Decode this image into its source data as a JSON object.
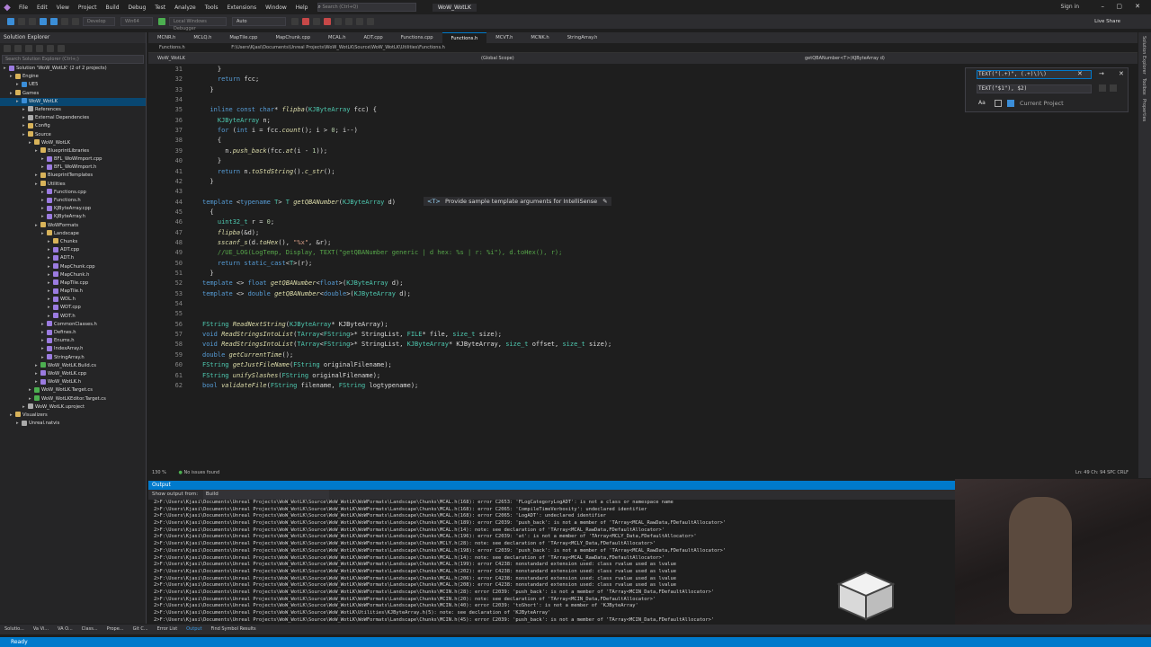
{
  "titlebar": {
    "menus": [
      "File",
      "Edit",
      "View",
      "Project",
      "Build",
      "Debug",
      "Test",
      "Analyze",
      "Tools",
      "Extensions",
      "Window",
      "Help"
    ],
    "search_placeholder": "Search (Ctrl+Q)",
    "solution_name": "WoW_WotLK",
    "signin": "Sign in",
    "liveshare": "Live Share"
  },
  "toolbar": {
    "config": "Develop",
    "platform": "Win64",
    "debugger": "Local Windows Debugger",
    "auto": "Auto"
  },
  "solution_explorer": {
    "title": "Solution Explorer",
    "search_placeholder": "Search Solution Explorer (Ctrl+;)",
    "items": [
      {
        "label": "Solution 'WoW_WotLK' (2 of 2 projects)",
        "indent": 0,
        "color": "#9b7be0"
      },
      {
        "label": "Engine",
        "indent": 1,
        "color": "#d8b35a"
      },
      {
        "label": "UE5",
        "indent": 2,
        "color": "#3b8ed8"
      },
      {
        "label": "Games",
        "indent": 1,
        "color": "#d8b35a"
      },
      {
        "label": "WoW_WotLK",
        "indent": 2,
        "color": "#3b8ed8",
        "selected": true
      },
      {
        "label": "References",
        "indent": 3,
        "color": "#aaaaaa"
      },
      {
        "label": "External Dependencies",
        "indent": 3,
        "color": "#aaaaaa"
      },
      {
        "label": "Config",
        "indent": 3,
        "color": "#d8b35a"
      },
      {
        "label": "Source",
        "indent": 3,
        "color": "#d8b35a"
      },
      {
        "label": "WoW_WotLK",
        "indent": 4,
        "color": "#d8b35a"
      },
      {
        "label": "BlueprintLibraries",
        "indent": 5,
        "color": "#d8b35a"
      },
      {
        "label": "BFL_WoWImport.cpp",
        "indent": 6,
        "color": "#9b7be0"
      },
      {
        "label": "BFL_WoWImport.h",
        "indent": 6,
        "color": "#9b7be0"
      },
      {
        "label": "BlueprintTemplates",
        "indent": 5,
        "color": "#d8b35a"
      },
      {
        "label": "Utilities",
        "indent": 5,
        "color": "#d8b35a"
      },
      {
        "label": "Functions.cpp",
        "indent": 6,
        "color": "#9b7be0"
      },
      {
        "label": "Functions.h",
        "indent": 6,
        "color": "#9b7be0"
      },
      {
        "label": "KJByteArray.cpp",
        "indent": 6,
        "color": "#9b7be0"
      },
      {
        "label": "KJByteArray.h",
        "indent": 6,
        "color": "#9b7be0"
      },
      {
        "label": "WoWFormats",
        "indent": 5,
        "color": "#d8b35a"
      },
      {
        "label": "Landscape",
        "indent": 6,
        "color": "#d8b35a"
      },
      {
        "label": "Chunks",
        "indent": 7,
        "color": "#d8b35a"
      },
      {
        "label": "ADT.cpp",
        "indent": 7,
        "color": "#9b7be0"
      },
      {
        "label": "ADT.h",
        "indent": 7,
        "color": "#9b7be0"
      },
      {
        "label": "MapChunk.cpp",
        "indent": 7,
        "color": "#9b7be0"
      },
      {
        "label": "MapChunk.h",
        "indent": 7,
        "color": "#9b7be0"
      },
      {
        "label": "MapTile.cpp",
        "indent": 7,
        "color": "#9b7be0"
      },
      {
        "label": "MapTile.h",
        "indent": 7,
        "color": "#9b7be0"
      },
      {
        "label": "WDL.h",
        "indent": 7,
        "color": "#9b7be0"
      },
      {
        "label": "WDT.cpp",
        "indent": 7,
        "color": "#9b7be0"
      },
      {
        "label": "WDT.h",
        "indent": 7,
        "color": "#9b7be0"
      },
      {
        "label": "CommonClasses.h",
        "indent": 6,
        "color": "#9b7be0"
      },
      {
        "label": "Defines.h",
        "indent": 6,
        "color": "#9b7be0"
      },
      {
        "label": "Enums.h",
        "indent": 6,
        "color": "#9b7be0"
      },
      {
        "label": "IndexArray.h",
        "indent": 6,
        "color": "#9b7be0"
      },
      {
        "label": "StringArray.h",
        "indent": 6,
        "color": "#9b7be0"
      },
      {
        "label": "WoW_WotLK.Build.cs",
        "indent": 5,
        "color": "#4caf50"
      },
      {
        "label": "WoW_WotLK.cpp",
        "indent": 5,
        "color": "#9b7be0"
      },
      {
        "label": "WoW_WotLK.h",
        "indent": 5,
        "color": "#9b7be0"
      },
      {
        "label": "WoW_WotLK.Target.cs",
        "indent": 4,
        "color": "#4caf50"
      },
      {
        "label": "WoW_WotLKEditor.Target.cs",
        "indent": 4,
        "color": "#4caf50"
      },
      {
        "label": "WoW_WotLK.uproject",
        "indent": 3,
        "color": "#aaaaaa"
      },
      {
        "label": "Visualizers",
        "indent": 1,
        "color": "#d8b35a"
      },
      {
        "label": "Unreal.natvis",
        "indent": 2,
        "color": "#aaaaaa"
      }
    ]
  },
  "tabs": [
    {
      "label": "MCNR.h"
    },
    {
      "label": "MCLQ.h"
    },
    {
      "label": "MapTile.cpp"
    },
    {
      "label": "MapChunk.cpp"
    },
    {
      "label": "MCAL.h"
    },
    {
      "label": "ADT.cpp"
    },
    {
      "label": "Functions.cpp"
    },
    {
      "label": "Functions.h",
      "active": true
    },
    {
      "label": "MCVT.h"
    },
    {
      "label": "MCNK.h"
    },
    {
      "label": "StringArray.h"
    }
  ],
  "pathbar": {
    "file": "Functions.h",
    "path": "F:\\Users\\Kjasi\\Documents\\Unreal Projects\\WoW_WotLK\\Source\\WoW_WotLK\\Utilities\\Functions.h"
  },
  "navbar": {
    "project": "WoW_WotLK",
    "scope": "(Global Scope)",
    "member": "getQBANumber<T>(KJByteArray d)"
  },
  "editor": {
    "lines": [
      {
        "n": "31",
        "html": "    }"
      },
      {
        "n": "32",
        "html": "    <span class=\"kw\">return</span> fcc;"
      },
      {
        "n": "33",
        "html": "  }"
      },
      {
        "n": "34",
        "html": ""
      },
      {
        "n": "35",
        "html": "  <span class=\"kw\">inline const char</span>* <span class=\"fn\">flipba</span>(<span class=\"ty\">KJByteArray</span> fcc) {"
      },
      {
        "n": "36",
        "html": "    <span class=\"ty\">KJByteArray</span> n;"
      },
      {
        "n": "37",
        "html": "    <span class=\"kw\">for</span> (<span class=\"kw\">int</span> i = fcc.<span class=\"fn\">count</span>(); i &gt; <span class=\"num\">0</span>; i--)"
      },
      {
        "n": "38",
        "html": "    {"
      },
      {
        "n": "39",
        "html": "      n.<span class=\"fn\">push_back</span>(fcc.<span class=\"fn\">at</span>(i - <span class=\"num\">1</span>));"
      },
      {
        "n": "40",
        "html": "    }"
      },
      {
        "n": "41",
        "html": "    <span class=\"kw\">return</span> n.<span class=\"fn\">toStdString</span>().<span class=\"fn\">c_str</span>();"
      },
      {
        "n": "42",
        "html": "  }"
      },
      {
        "n": "43",
        "html": ""
      },
      {
        "n": "44",
        "html": "<span class=\"kw\">template</span> &lt;<span class=\"kw\">typename</span> <span class=\"ty\">T</span>&gt; <span class=\"ty\">T</span> <span class=\"fn\">getQBANumber</span>(<span class=\"ty\">KJByteArray</span> d)"
      },
      {
        "n": "45",
        "html": "  {"
      },
      {
        "n": "46",
        "html": "    <span class=\"ty\">uint32_t</span> r = <span class=\"num\">0</span>;"
      },
      {
        "n": "47",
        "html": "    <span class=\"fn\">flipba</span>(&amp;d);"
      },
      {
        "n": "48",
        "html": "    <span class=\"fn\">sscanf_s</span>(d.<span class=\"fn\">toHex</span>(), <span class=\"str\">\"%x\"</span>, &amp;r);"
      },
      {
        "n": "49",
        "html": "    <span class=\"cm\">//UE_LOG(LogTemp, Display, TEXT(\"getQBANumber generic | d hex: %s | r: %i\"), d.toHex(), r);</span>"
      },
      {
        "n": "50",
        "html": "    <span class=\"kw\">return</span> <span class=\"kw\">static_cast</span>&lt;<span class=\"ty\">T</span>&gt;(r);"
      },
      {
        "n": "51",
        "html": "  }"
      },
      {
        "n": "52",
        "html": "<span class=\"kw\">template</span> &lt;&gt; <span class=\"kw\">float</span> <span class=\"fn\">getQBANumber</span>&lt;<span class=\"kw\">float</span>&gt;(<span class=\"ty\">KJByteArray</span> d);"
      },
      {
        "n": "53",
        "html": "<span class=\"kw\">template</span> &lt;&gt; <span class=\"kw\">double</span> <span class=\"fn\">getQBANumber</span>&lt;<span class=\"kw\">double</span>&gt;(<span class=\"ty\">KJByteArray</span> d);"
      },
      {
        "n": "54",
        "html": ""
      },
      {
        "n": "55",
        "html": ""
      },
      {
        "n": "56",
        "html": "<span class=\"ty\">FString</span> <span class=\"fn\">ReadNextString</span>(<span class=\"ty\">KJByteArray</span>* KJByteArray);"
      },
      {
        "n": "57",
        "html": "<span class=\"kw\">void</span> <span class=\"fn\">ReadStringsIntoList</span>(<span class=\"ty\">TArray</span>&lt;<span class=\"ty\">FString</span>&gt;* StringList, <span class=\"ty\">FILE</span>* file, <span class=\"ty\">size_t</span> size);"
      },
      {
        "n": "58",
        "html": "<span class=\"kw\">void</span> <span class=\"fn\">ReadStringsIntoList</span>(<span class=\"ty\">TArray</span>&lt;<span class=\"ty\">FString</span>&gt;* StringList, <span class=\"ty\">KJByteArray</span>* KJByteArray, <span class=\"ty\">size_t</span> offset, <span class=\"ty\">size_t</span> size);"
      },
      {
        "n": "59",
        "html": "<span class=\"kw\">double</span> <span class=\"fn\">getCurrentTime</span>();"
      },
      {
        "n": "60",
        "html": "<span class=\"ty\">FString</span> <span class=\"fn\">getJustFileName</span>(<span class=\"ty\">FString</span> originalFilename);"
      },
      {
        "n": "61",
        "html": "<span class=\"ty\">FString</span> <span class=\"fn\">unifySlashes</span>(<span class=\"ty\">FString</span> originalFilename);"
      },
      {
        "n": "62",
        "html": "<span class=\"kw\">bool</span> <span class=\"fn\">validateFile</span>(<span class=\"ty\">FString</span> filename, <span class=\"ty\">FString</span> logtypename);"
      }
    ],
    "hint_badge": "<T>",
    "hint_text": "Provide sample template arguments for IntelliSense"
  },
  "find_widget": {
    "find_text": "TEXT(\"(.+)\", (.+)\\)\\)",
    "replace_text": "TEXT(\"$1\"), $2)",
    "scope": "Current Project",
    "match_case": "Aa"
  },
  "editor_status": {
    "zoom": "130 %",
    "issues": "No issues found",
    "position": "Ln: 49   Ch: 94   SPC   CRLF"
  },
  "output": {
    "title": "Output",
    "show_from_label": "Show output from:",
    "show_from_value": "Build",
    "lines": [
      "2>F:\\Users\\Kjasi\\Documents\\Unreal Projects\\WoW_WotLK\\Source\\WoW_WotLK\\WoWFormats\\Landscape\\Chunks\\MCAL.h(168): error C2653: 'FLogCategoryLogADT': is not a class or namespace name",
      "2>F:\\Users\\Kjasi\\Documents\\Unreal Projects\\WoW_WotLK\\Source\\WoW_WotLK\\WoWFormats\\Landscape\\Chunks\\MCAL.h(168): error C2065: 'CompileTimeVerbosity': undeclared identifier",
      "2>F:\\Users\\Kjasi\\Documents\\Unreal Projects\\WoW_WotLK\\Source\\WoW_WotLK\\WoWFormats\\Landscape\\Chunks\\MCAL.h(168): error C2065: 'LogADT': undeclared identifier",
      "2>F:\\Users\\Kjasi\\Documents\\Unreal Projects\\WoW_WotLK\\Source\\WoW_WotLK\\WoWFormats\\Landscape\\Chunks\\MCAL.h(189): error C2039: 'push_back': is not a member of 'TArray<MCAL_RawData,FDefaultAllocator>'",
      "2>F:\\Users\\Kjasi\\Documents\\Unreal Projects\\WoW_WotLK\\Source\\WoW_WotLK\\WoWFormats\\Landscape\\Chunks\\MCAL.h(14): note: see declaration of 'TArray<MCAL_RawData,FDefaultAllocator>'",
      "2>F:\\Users\\Kjasi\\Documents\\Unreal Projects\\WoW_WotLK\\Source\\WoW_WotLK\\WoWFormats\\Landscape\\Chunks\\MCAL.h(196): error C2039: 'at': is not a member of 'TArray<MCLY_Data,FDefaultAllocator>'",
      "2>F:\\Users\\Kjasi\\Documents\\Unreal Projects\\WoW_WotLK\\Source\\WoW_WotLK\\WoWFormats\\Landscape\\Chunks\\MCLY.h(28): note: see declaration of 'TArray<MCLY_Data,FDefaultAllocator>'",
      "2>F:\\Users\\Kjasi\\Documents\\Unreal Projects\\WoW_WotLK\\Source\\WoW_WotLK\\WoWFormats\\Landscape\\Chunks\\MCAL.h(198): error C2039: 'push_back': is not a member of 'TArray<MCAL_RawData,FDefaultAllocator>'",
      "2>F:\\Users\\Kjasi\\Documents\\Unreal Projects\\WoW_WotLK\\Source\\WoW_WotLK\\WoWFormats\\Landscape\\Chunks\\MCAL.h(14): note: see declaration of 'TArray<MCAL_RawData,FDefaultAllocator>'",
      "2>F:\\Users\\Kjasi\\Documents\\Unreal Projects\\WoW_WotLK\\Source\\WoW_WotLK\\WoWFormats\\Landscape\\Chunks\\MCAL.h(199): error C4238: nonstandard extension used: class rvalue used as lvalue",
      "2>F:\\Users\\Kjasi\\Documents\\Unreal Projects\\WoW_WotLK\\Source\\WoW_WotLK\\WoWFormats\\Landscape\\Chunks\\MCAL.h(202): error C4238: nonstandard extension used: class rvalue used as lvalue",
      "2>F:\\Users\\Kjasi\\Documents\\Unreal Projects\\WoW_WotLK\\Source\\WoW_WotLK\\WoWFormats\\Landscape\\Chunks\\MCAL.h(206): error C4238: nonstandard extension used: class rvalue used as lvalue",
      "2>F:\\Users\\Kjasi\\Documents\\Unreal Projects\\WoW_WotLK\\Source\\WoW_WotLK\\WoWFormats\\Landscape\\Chunks\\MCAL.h(208): error C4238: nonstandard extension used: class rvalue used as lvalue",
      "2>F:\\Users\\Kjasi\\Documents\\Unreal Projects\\WoW_WotLK\\Source\\WoW_WotLK\\WoWFormats\\Landscape\\Chunks\\MCIN.h(28): error C2039: 'push_back': is not a member of 'TArray<MCIN_Data,FDefaultAllocator>'",
      "2>F:\\Users\\Kjasi\\Documents\\Unreal Projects\\WoW_WotLK\\Source\\WoW_WotLK\\WoWFormats\\Landscape\\Chunks\\MCIN.h(20): note: see declaration of 'TArray<MCIN_Data,FDefaultAllocator>'",
      "2>F:\\Users\\Kjasi\\Documents\\Unreal Projects\\WoW_WotLK\\Source\\WoW_WotLK\\WoWFormats\\Landscape\\Chunks\\MCIN.h(40): error C2039: 'toShort': is not a member of 'KJByteArray'",
      "2>F:\\Users\\Kjasi\\Documents\\Unreal Projects\\WoW_WotLK\\Source\\WoW_WotLK\\Utilities\\KJByteArray.h(5): note: see declaration of 'KJByteArray'",
      "2>F:\\Users\\Kjasi\\Documents\\Unreal Projects\\WoW_WotLK\\Source\\WoW_WotLK\\WoWFormats\\Landscape\\Chunks\\MCIN.h(45): error C2039: 'push_back': is not a member of 'TArray<MCIN_Data,FDefaultAllocator>'"
    ]
  },
  "bottom_tabs": [
    "Solutio...",
    "Va Vi...",
    "VA O...",
    "Class...",
    "Prope...",
    "Git C...",
    "Error List",
    "Output",
    "Find Symbol Results"
  ],
  "statusbar": {
    "text": "Ready"
  },
  "right_sidebar": [
    "Solution Explorer",
    "Toolbox",
    "Properties"
  ]
}
